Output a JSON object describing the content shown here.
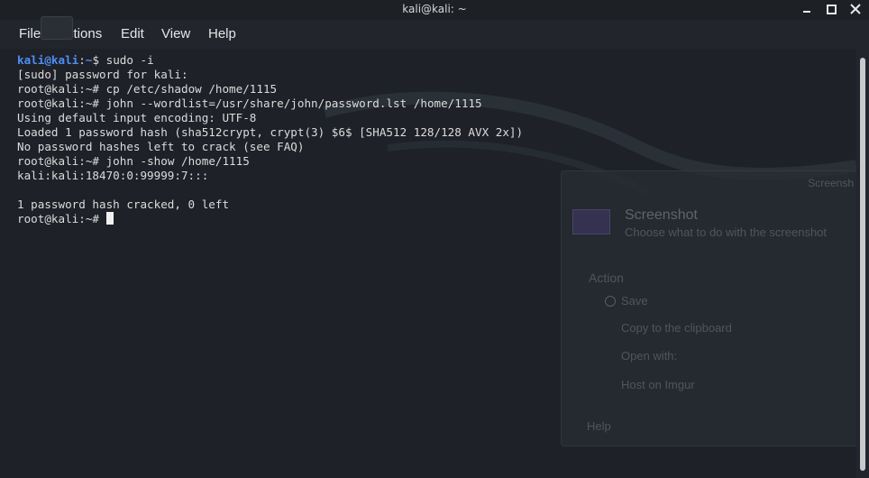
{
  "window": {
    "title": "kali@kali: ~"
  },
  "menu": [
    "File",
    "Actions",
    "Edit",
    "View",
    "Help"
  ],
  "terminal": {
    "user_prompt": {
      "user": "kali@kali",
      "sep": ":",
      "path": "~",
      "symbol": "$"
    },
    "lines": [
      {
        "kind": "user_prompt",
        "command": " sudo -i"
      },
      {
        "kind": "output",
        "text": "[sudo] password for kali:"
      },
      {
        "kind": "root_prompt",
        "prompt": "root@kali:~#",
        "command": " cp /etc/shadow /home/1115"
      },
      {
        "kind": "root_prompt",
        "prompt": "root@kali:~#",
        "command": " john --wordlist=/usr/share/john/password.lst /home/1115"
      },
      {
        "kind": "output",
        "text": "Using default input encoding: UTF-8"
      },
      {
        "kind": "output",
        "text": "Loaded 1 password hash (sha512crypt, crypt(3) $6$ [SHA512 128/128 AVX 2x])"
      },
      {
        "kind": "output",
        "text": "No password hashes left to crack (see FAQ)"
      },
      {
        "kind": "root_prompt",
        "prompt": "root@kali:~#",
        "command": " john -show /home/1115"
      },
      {
        "kind": "output",
        "text": "kali:kali:18470:0:99999:7:::"
      },
      {
        "kind": "output",
        "text": ""
      },
      {
        "kind": "output",
        "text": "1 password hash cracked, 0 left"
      },
      {
        "kind": "root_prompt",
        "prompt": "root@kali:~#",
        "command": " ",
        "cursor": true
      }
    ]
  },
  "ghost_dialog": {
    "corner": "Screensh",
    "title": "Screenshot",
    "subtitle": "Choose what to do with the screenshot",
    "section": "Action",
    "options": [
      "Save",
      "Copy to the clipboard",
      "Open with:",
      "Host on Imgur"
    ],
    "help": "Help"
  },
  "colors": {
    "prompt_blue": "#4f8ef7",
    "text": "#dcdcdc",
    "background": "#1e2127"
  }
}
